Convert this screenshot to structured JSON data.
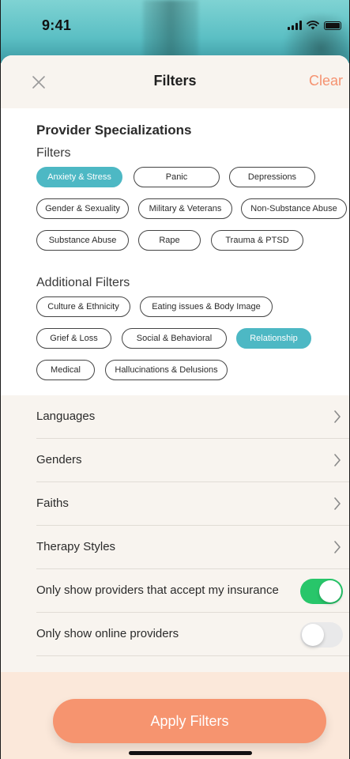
{
  "status_bar": {
    "time": "9:41"
  },
  "header": {
    "title": "Filters",
    "clear_label": "Clear"
  },
  "specializations": {
    "title": "Provider Specializations",
    "filters_label": "Filters",
    "filters": [
      {
        "label": "Anxiety & Stress",
        "selected": true
      },
      {
        "label": "Panic",
        "selected": false
      },
      {
        "label": "Depressions",
        "selected": false
      },
      {
        "label": "Gender & Sexuality",
        "selected": false
      },
      {
        "label": "Military & Veterans",
        "selected": false
      },
      {
        "label": "Non-Substance Abuse",
        "selected": false
      },
      {
        "label": "Substance Abuse",
        "selected": false
      },
      {
        "label": "Rape",
        "selected": false
      },
      {
        "label": "Trauma & PTSD",
        "selected": false
      }
    ],
    "additional_label": "Additional Filters",
    "additional": [
      {
        "label": "Culture & Ethnicity",
        "selected": false
      },
      {
        "label": "Eating issues & Body Image",
        "selected": false
      },
      {
        "label": "Grief & Loss",
        "selected": false
      },
      {
        "label": "Social & Behavioral",
        "selected": false
      },
      {
        "label": "Relationship",
        "selected": true
      },
      {
        "label": "Medical",
        "selected": false
      },
      {
        "label": "Hallucinations & Delusions",
        "selected": false
      }
    ]
  },
  "list": {
    "languages": "Languages",
    "genders": "Genders",
    "faiths": "Faiths",
    "therapy_styles": "Therapy Styles",
    "insurance_label": "Only show providers that accept my insurance",
    "insurance_on": true,
    "online_label": "Only show online providers",
    "online_on": false
  },
  "footer": {
    "apply_label": "Apply Filters"
  },
  "colors": {
    "accent_teal": "#4db8c4",
    "accent_orange": "#f6946f",
    "toggle_on": "#28c66a"
  }
}
